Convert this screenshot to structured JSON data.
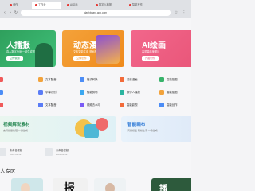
{
  "browser": {
    "tabs": [
      {
        "label": "创作"
      },
      {
        "label": "工作台"
      },
      {
        "label": "AI绘画"
      },
      {
        "label": "数字人播报"
      },
      {
        "label": "智能写作"
      }
    ],
    "url": "dashboard.app.com",
    "accent": "#e53935"
  },
  "banners": [
    {
      "title": "人播报",
      "subtitle": "真人数字分身 一键生成视频",
      "button": "立即使用"
    },
    {
      "title": "动态漫画",
      "subtitle": "文本智能生成 漫画视频",
      "button": "立即创作"
    },
    {
      "title": "AI绘画",
      "subtitle": "高质量精美图片",
      "button": "开始创作"
    }
  ],
  "tools": {
    "row1": [
      "",
      "文本配音",
      "格式转换",
      "动态漫画",
      "智能抠图"
    ],
    "row2": [
      "",
      "字幕识别",
      "智能剪辑",
      "数字人播报",
      "智能抠图"
    ],
    "row3": [
      "",
      "文本配音",
      "视频去水印",
      "智能影视",
      "智能创作"
    ]
  },
  "cards": [
    {
      "title": "视频解说素材",
      "subtitle": "支持批量处理 一键生成"
    },
    {
      "title": "智能画布",
      "subtitle": "海量模板 轻松上手 一键生成"
    }
  ],
  "files": [
    {
      "name": "未命名视频",
      "date": "2024-04-19"
    },
    {
      "name": "未命名视频",
      "date": "2024-04-19"
    }
  ],
  "section_title": "人专区",
  "thumb_chars": [
    "报",
    "播"
  ]
}
